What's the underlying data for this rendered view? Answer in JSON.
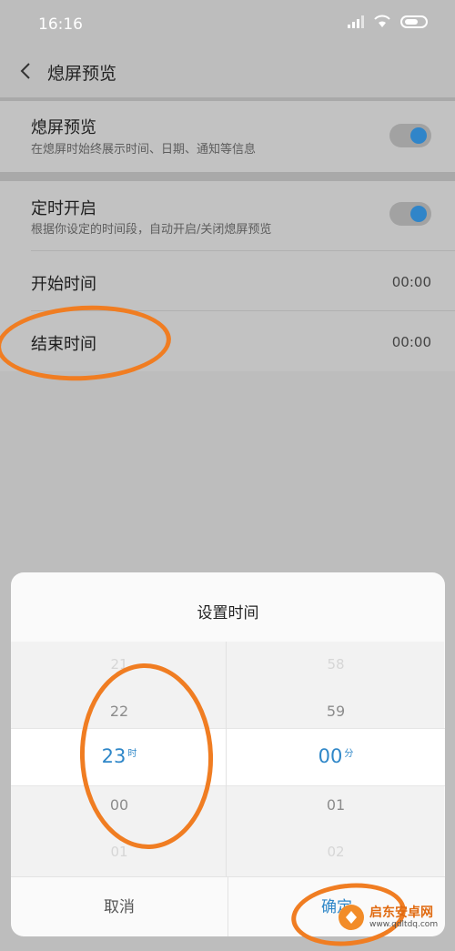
{
  "status_bar": {
    "time": "16:16",
    "icons": [
      "signal-icon",
      "wifi-icon",
      "battery-icon"
    ]
  },
  "header": {
    "title": "熄屏预览",
    "back_icon": "back-chevron-icon"
  },
  "settings": {
    "preview": {
      "title": "熄屏预览",
      "desc": "在熄屏时始终展示时间、日期、通知等信息",
      "enabled": true
    },
    "schedule": {
      "title": "定时开启",
      "desc": "根据你设定的时间段，自动开启/关闭熄屏预览",
      "enabled": true
    },
    "start": {
      "label": "开始时间",
      "value": "00:00"
    },
    "end": {
      "label": "结束时间",
      "value": "00:00"
    }
  },
  "dialog": {
    "title": "设置时间",
    "hours": {
      "above2": "21",
      "above1": "22",
      "selected": "23",
      "unit": "时",
      "below1": "00",
      "below2": "01"
    },
    "minutes": {
      "above2": "58",
      "above1": "59",
      "selected": "00",
      "unit": "分",
      "below1": "01",
      "below2": "02"
    },
    "cancel": "取消",
    "confirm": "确定"
  },
  "watermark": {
    "title": "启东安卓网",
    "url": "www.qdltdq.com"
  },
  "colors": {
    "accent": "#2f87c8",
    "annotation": "#f07d22",
    "overlay": "#bdbdbd"
  }
}
